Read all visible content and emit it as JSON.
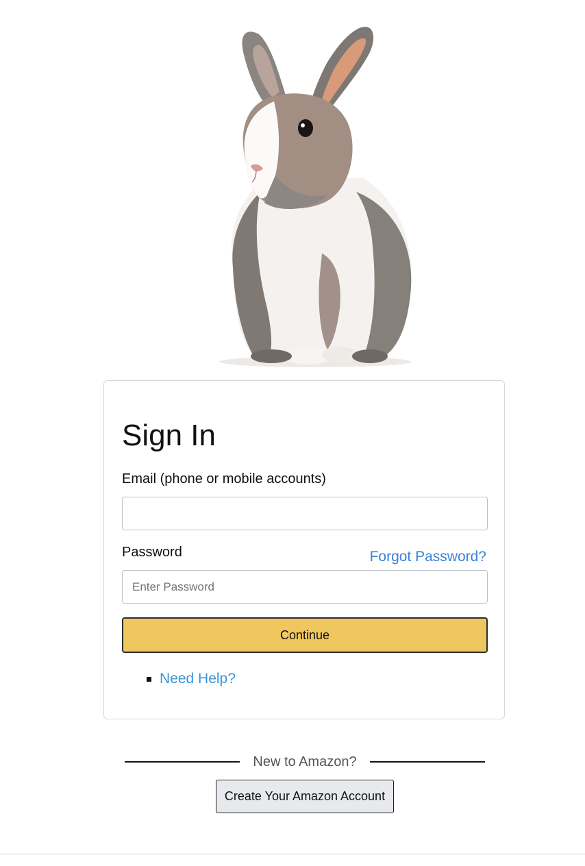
{
  "signin": {
    "title": "Sign In",
    "email_label": "Email (phone or mobile accounts)",
    "email_value": "",
    "password_label": "Password",
    "forgot_link": "Forgot Password?",
    "password_placeholder": "Enter Password",
    "continue_label": "Continue",
    "help_link": "Need Help?"
  },
  "new_customer": {
    "divider_text": "New to Amazon?",
    "create_button": "Create Your Amazon Account"
  },
  "colors": {
    "continue_bg": "#f0c75e",
    "link": "#3b82d6",
    "create_bg": "#e7e9ec"
  },
  "hero": {
    "icon": "rabbit-image"
  }
}
